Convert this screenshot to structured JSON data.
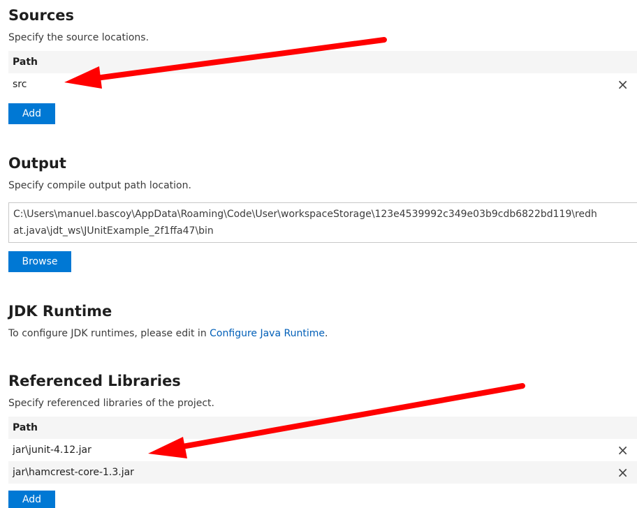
{
  "sources": {
    "title": "Sources",
    "description": "Specify the source locations.",
    "column_header": "Path",
    "rows": [
      {
        "path": "src",
        "remove_icon": "×"
      }
    ],
    "add_label": "Add"
  },
  "output": {
    "title": "Output",
    "description": "Specify compile output path location.",
    "value_line1": "C:\\Users\\manuel.bascoy\\AppData\\Roaming\\Code\\User\\workspaceStorage\\123e4539992c349e03b9cdb6822bd119\\redh",
    "value_line2": "at.java\\jdt_ws\\JUnitExample_2f1ffa47\\bin",
    "browse_label": "Browse"
  },
  "jdk": {
    "title": "JDK Runtime",
    "description_prefix": "To configure JDK runtimes, please edit in ",
    "link_text": "Configure Java Runtime",
    "description_suffix": "."
  },
  "libraries": {
    "title": "Referenced Libraries",
    "description": "Specify referenced libraries of the project.",
    "column_header": "Path",
    "rows": [
      {
        "path": "jar\\junit-4.12.jar",
        "remove_icon": "×"
      },
      {
        "path": "jar\\hamcrest-core-1.3.jar",
        "remove_icon": "×"
      }
    ],
    "add_label": "Add"
  },
  "colors": {
    "accent": "#0078d4",
    "link": "#005fb8",
    "annotation_arrow": "#ff0000"
  }
}
